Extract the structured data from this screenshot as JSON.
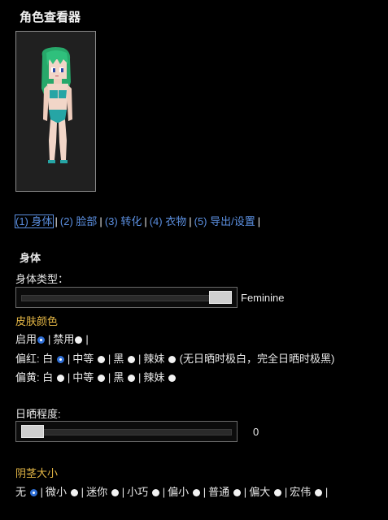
{
  "title": "角色查看器",
  "tabs": [
    {
      "label": "(1) 身体",
      "active": true
    },
    {
      "label": "(2) 脸部"
    },
    {
      "label": "(3) 转化"
    },
    {
      "label": "(4) 衣物"
    },
    {
      "label": "(5) 导出/设置"
    }
  ],
  "section_title": "身体",
  "body_type": {
    "label": "身体类型：",
    "value_label": "Feminine",
    "level": 1.0
  },
  "skin": {
    "heading": "皮肤颜色",
    "enable": {
      "on": "启用",
      "off": "禁用",
      "selected": "on"
    },
    "red_label": "偏红:",
    "yellow_label": "偏黄:",
    "options": [
      "白",
      "中等",
      "黑",
      "辣妹"
    ],
    "red_selected": 0,
    "note": "(无日晒时极白，完全日晒时极黑)"
  },
  "tan": {
    "label": "日晒程度:",
    "value": "0",
    "level": 0
  },
  "size": {
    "heading": "阴茎大小",
    "options": [
      "无",
      "微小",
      "迷你",
      "小巧",
      "偏小",
      "普通",
      "偏大",
      "宏伟"
    ],
    "selected": 0
  },
  "colors": {
    "accent_link": "#5b8fe0",
    "heading_gold": "#e6b846",
    "radio_selected": "#2f6fd6",
    "hair": "#27a86a",
    "swimsuit": "#26a5a5"
  }
}
